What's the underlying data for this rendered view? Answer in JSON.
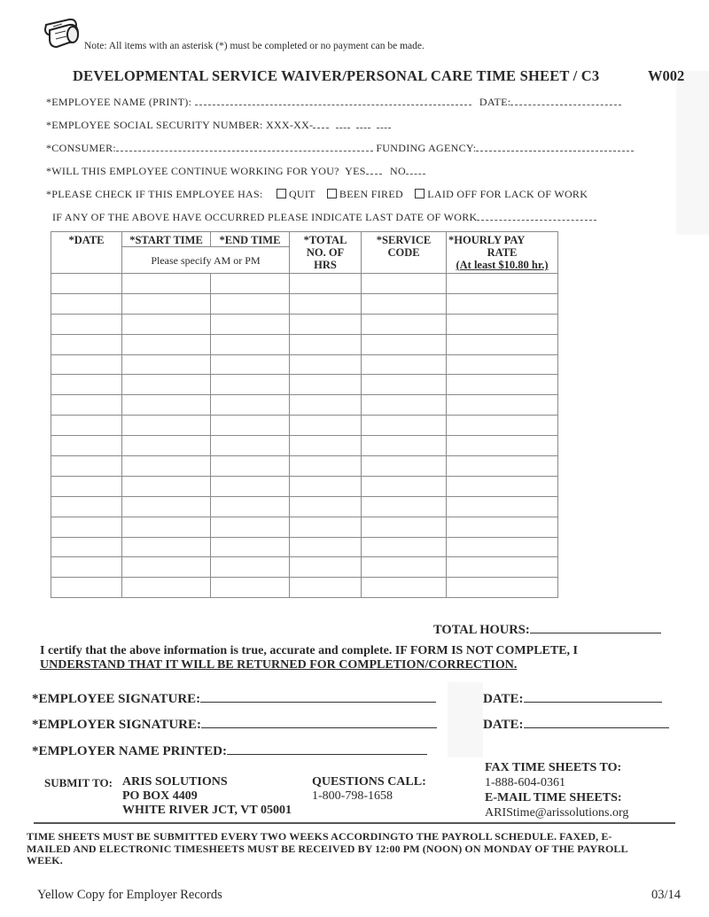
{
  "header": {
    "note": "Note:  All items with an asterisk (*) must be completed or no payment can be made.",
    "title": "DEVELOPMENTAL SERVICE WAIVER/PERSONAL CARE TIME SHEET / C3",
    "form_code": "W002",
    "logo_icon": "logs-icon"
  },
  "fields": {
    "employee_name_label": "*EMPLOYEE NAME (PRINT):",
    "employee_name_value": "",
    "date_label": "DATE:",
    "date_value": "",
    "ssn_label": "*EMPLOYEE SOCIAL SECURITY NUMBER: XXX-XX-",
    "ssn_value": "",
    "consumer_label": "*CONSUMER:",
    "consumer_value": "",
    "funding_agency_label": "FUNDING AGENCY:",
    "funding_agency_value": "",
    "continue_question": "*WILL THIS EMPLOYEE CONTINUE WORKING FOR YOU?",
    "yes_label": "YES",
    "no_label": "NO",
    "check_label": "*PLEASE CHECK IF THIS EMPLOYEE HAS:",
    "checkboxes": [
      {
        "label": "QUIT",
        "checked": false
      },
      {
        "label": "BEEN FIRED",
        "checked": false
      },
      {
        "label": "LAID OFF FOR LACK OF WORK",
        "checked": false
      }
    ],
    "last_date_label": "IF ANY OF THE ABOVE HAVE OCCURRED PLEASE INDICATE LAST DATE OF WORK",
    "last_date_value": ""
  },
  "table": {
    "headers": {
      "date": "*DATE",
      "start_time": "*START TIME",
      "end_time": "*END TIME",
      "ampm_note": "Please specify AM or PM",
      "total_line1": "*TOTAL",
      "total_line2": "NO. OF",
      "total_line3": "HRS",
      "service_line1": "*SERVICE",
      "service_line2": "CODE",
      "rate_line1": "*HOURLY PAY",
      "rate_line2": "RATE",
      "rate_line3": "(At least $10.80 hr.)"
    },
    "rows": [
      [
        "",
        "",
        "",
        "",
        "",
        ""
      ],
      [
        "",
        "",
        "",
        "",
        "",
        ""
      ],
      [
        "",
        "",
        "",
        "",
        "",
        ""
      ],
      [
        "",
        "",
        "",
        "",
        "",
        ""
      ],
      [
        "",
        "",
        "",
        "",
        "",
        ""
      ],
      [
        "",
        "",
        "",
        "",
        "",
        ""
      ],
      [
        "",
        "",
        "",
        "",
        "",
        ""
      ],
      [
        "",
        "",
        "",
        "",
        "",
        ""
      ],
      [
        "",
        "",
        "",
        "",
        "",
        ""
      ],
      [
        "",
        "",
        "",
        "",
        "",
        ""
      ],
      [
        "",
        "",
        "",
        "",
        "",
        ""
      ],
      [
        "",
        "",
        "",
        "",
        "",
        ""
      ],
      [
        "",
        "",
        "",
        "",
        "",
        ""
      ],
      [
        "",
        "",
        "",
        "",
        "",
        ""
      ],
      [
        "",
        "",
        "",
        "",
        "",
        ""
      ],
      [
        "",
        "",
        "",
        "",
        "",
        ""
      ]
    ],
    "total_hours_label": "TOTAL HOURS:",
    "total_hours_value": ""
  },
  "certification": {
    "line1": "I certify that the above information is true, accurate and complete.  IF FORM IS NOT COMPLETE, I",
    "line2": "UNDERSTAND THAT IT WILL BE RETURNED FOR COMPLETION/CORRECTION."
  },
  "signatures": {
    "employee_sig_label": "*EMPLOYEE  SIGNATURE:",
    "employer_sig_label": "*EMPLOYER  SIGNATURE:",
    "employer_name_label": "*EMPLOYER  NAME PRINTED:",
    "date_label": "DATE:"
  },
  "contact": {
    "submit_label": "SUBMIT TO:",
    "submit_lines": [
      "ARIS SOLUTIONS",
      "PO BOX 4409",
      "WHITE RIVER JCT, VT 05001"
    ],
    "questions_label": "QUESTIONS CALL:",
    "questions_phone": "1-800-798-1658",
    "fax_label": "FAX TIME SHEETS TO:",
    "fax_number": "1-888-604-0361",
    "email_label": "E-MAIL TIME SHEETS:",
    "email": "ARIStime@arissolutions.org"
  },
  "notice": {
    "line1": "TIME SHEETS MUST BE SUBMITTED  EVERY TWO WEEKS ACCORDINGTO THE PAYROLL SCHEDULE.  FAXED, E-",
    "line2": "MAILED AND ELECTRONIC TIMESHEETS MUST BE RECEIVED BY 12:00 PM (NOON) ON MONDAY OF THE PAYROLL",
    "line3": "WEEK."
  },
  "footer": {
    "copy_label": "Yellow Copy for Employer  Records",
    "revision": "03/14"
  }
}
